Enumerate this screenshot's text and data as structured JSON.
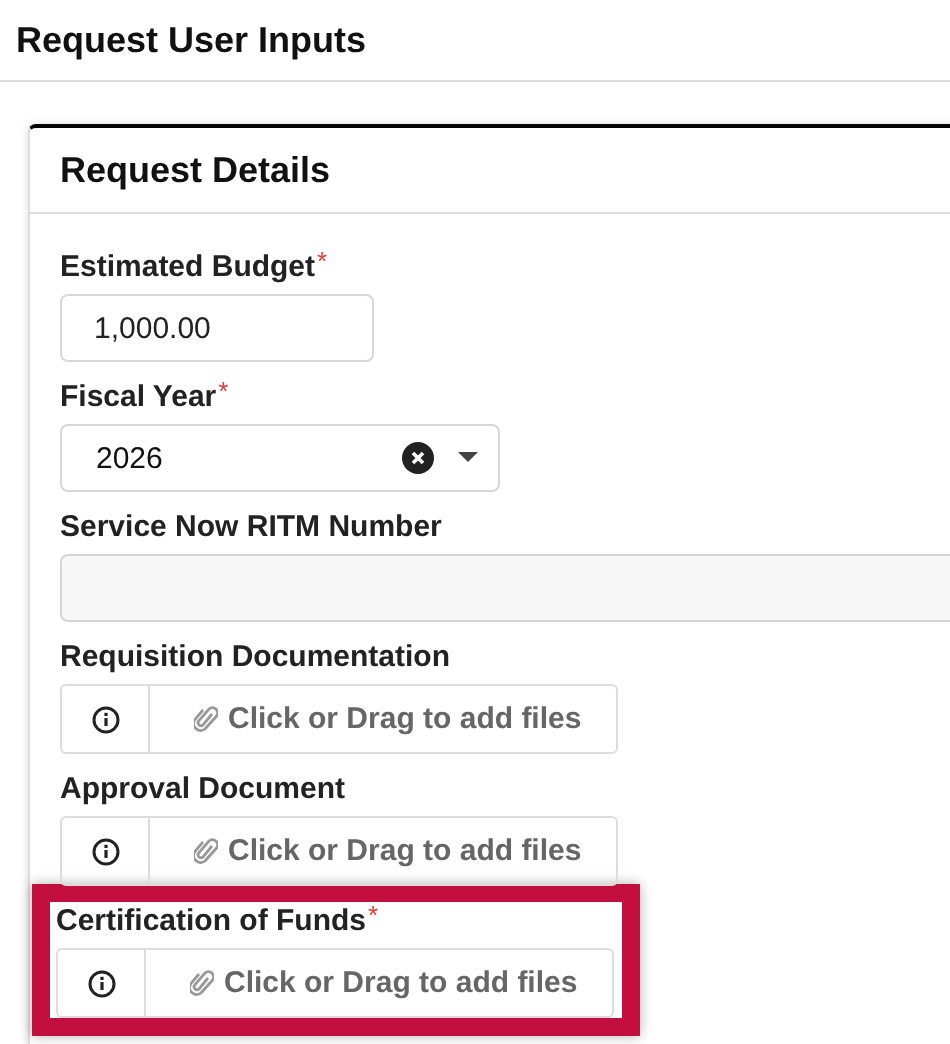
{
  "page_title": "Request User Inputs",
  "card": {
    "title": "Request Details",
    "fields": [
      {
        "kind": "text",
        "label": "Estimated Budget",
        "required_mark": "*",
        "value": "1,000.00"
      },
      {
        "kind": "select",
        "label": "Fiscal Year",
        "required_mark": "*",
        "value": "2026"
      },
      {
        "kind": "readonly",
        "label": "Service Now RITM Number"
      },
      {
        "kind": "file",
        "label": "Requisition Documentation",
        "prompt": "Click or Drag to add files",
        "highlighted": false
      },
      {
        "kind": "file",
        "label": "Approval Document",
        "prompt": "Click or Drag to add files",
        "highlighted": false
      },
      {
        "kind": "file",
        "label": "Certification of Funds",
        "required_mark": "*",
        "prompt": "Click or Drag to add files",
        "highlighted": true
      }
    ]
  }
}
